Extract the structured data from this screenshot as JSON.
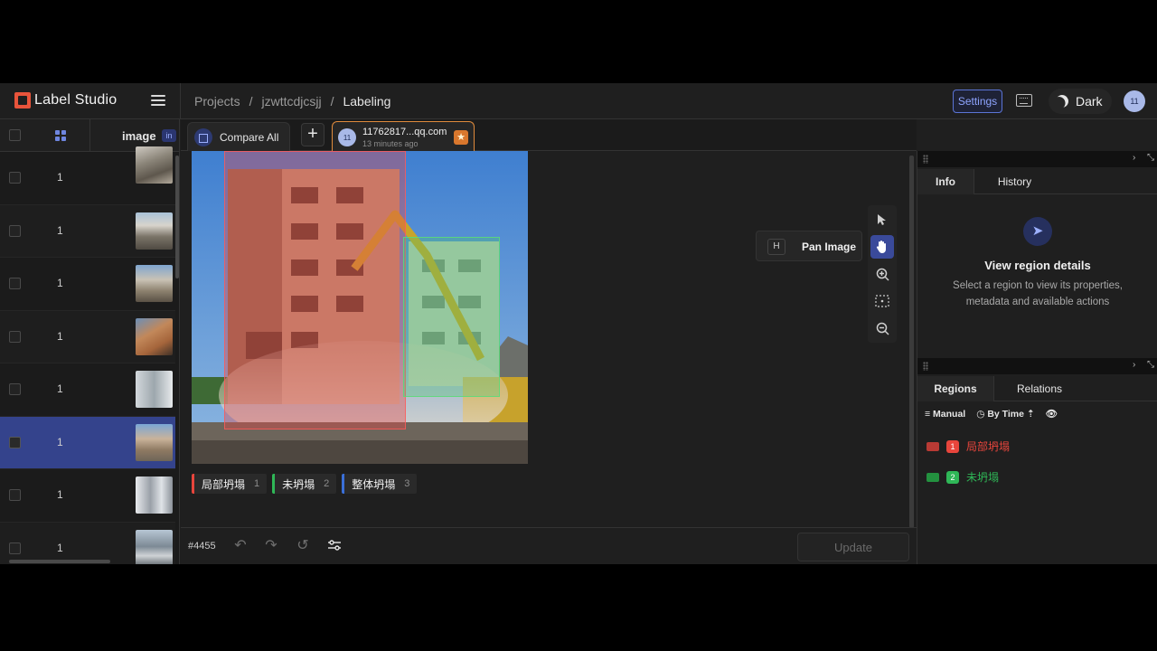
{
  "app": {
    "name": "Label Studio"
  },
  "breadcrumb": {
    "projects": "Projects",
    "sep": "/",
    "project": "jzwttcdjcsjj",
    "current": "Labeling"
  },
  "header": {
    "settings": "Settings",
    "theme": "Dark",
    "avatar": "11"
  },
  "list": {
    "column_image": "image",
    "column_badge": "in",
    "rows": [
      {
        "value": "1"
      },
      {
        "value": "1"
      },
      {
        "value": "1"
      },
      {
        "value": "1"
      },
      {
        "value": "1"
      },
      {
        "value": "1"
      },
      {
        "value": "1"
      },
      {
        "value": "1"
      }
    ],
    "selected_index": 5
  },
  "tabs": {
    "compare": "Compare All",
    "plus": "+",
    "annotation": {
      "avatar": "11",
      "title": "11762817...qq.com",
      "subtitle": "13 minutes ago"
    }
  },
  "labels": [
    {
      "name": "局部坍塌",
      "hotkey": "1",
      "color": "#e8453c"
    },
    {
      "name": "未坍塌",
      "hotkey": "2",
      "color": "#2fb757"
    },
    {
      "name": "整体坍塌",
      "hotkey": "3",
      "color": "#3a6fd8"
    }
  ],
  "tooltip": {
    "key": "H",
    "text": "Pan Image"
  },
  "bottom": {
    "task_id": "#4455",
    "update": "Update"
  },
  "info_panel": {
    "tabs": [
      "Info",
      "History"
    ],
    "title": "View region details",
    "description": "Select a region to view its properties, metadata and available actions"
  },
  "regions_panel": {
    "tabs": [
      "Regions",
      "Relations"
    ],
    "sort_manual": "Manual",
    "sort_time": "By Time",
    "items": [
      {
        "index": "1",
        "label": "局部坍塌",
        "color": "#e8453c"
      },
      {
        "index": "2",
        "label": "未坍塌",
        "color": "#2fb757"
      }
    ]
  }
}
